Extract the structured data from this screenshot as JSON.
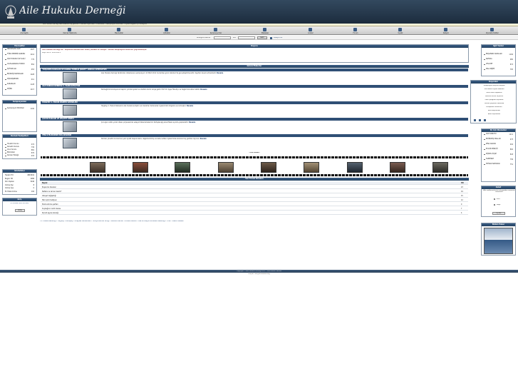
{
  "header": {
    "title": "Aile Hukuku Derneği",
    "ticker": "Aile Hukuku Derneği web sitesine hoş geldiniz • Dernek duyuruları • Etkinlikler • Sempozyum bildirileri • Üyelik bilgileri için tıklayınız"
  },
  "nav": [
    {
      "label": "Ana Sayfa"
    },
    {
      "label": "Dernek Hakkında"
    },
    {
      "label": "Mevzuatlar"
    },
    {
      "label": "Içtihatlar"
    },
    {
      "label": "Sempozyumlar"
    },
    {
      "label": "Makaleler"
    },
    {
      "label": "Linkler"
    },
    {
      "label": "Forum"
    },
    {
      "label": "Üyelik"
    },
    {
      "label": "İletişim"
    },
    {
      "label": "Ziyaretçi Defteri"
    }
  ],
  "search": {
    "label": "Aradığınız Kelime",
    "in_label": "Ara",
    "go": "Getir",
    "advanced": "Detaylı Ara"
  },
  "left": {
    "box1_title": "Mevzuatlar",
    "box1_items": [
      {
        "label": "ANAYASADA AİLE",
        "count": "1027"
      },
      {
        "label": "TÜRK MEDENİ KANUNU",
        "count": "1214"
      },
      {
        "label": "AİLE HUKUKU İLE İLGİLİ",
        "count": "779"
      },
      {
        "label": "ULUSLARARASI HUKUK",
        "count": "854"
      },
      {
        "label": "İÇTİHATLAR",
        "count": "953"
      },
      {
        "label": "BİLİRKİŞİ RAPORLARI",
        "count": "1028"
      },
      {
        "label": "SÖZLEŞMELER",
        "count": "911"
      },
      {
        "label": "KARARLAR",
        "count": "1128"
      },
      {
        "label": "DİĞER",
        "count": "1217"
      }
    ],
    "box2_title": "Sempozyumlar",
    "box2_items": [
      {
        "label": "Sempozyum Bildirileri",
        "count": "1190"
      }
    ],
    "box3_title": "Dernek Faaliyetleri",
    "box3_items": [
      {
        "label": "Yönetim Kurulu",
        "count": "974"
      },
      {
        "label": "Denetim Kurulu",
        "count": "736"
      },
      {
        "label": "Onur Kurulu",
        "count": "881"
      },
      {
        "label": "Etkinlikler",
        "count": "879"
      },
      {
        "label": "Dernek Tüzüğü",
        "count": "933"
      }
    ],
    "stats_title": "İstatistikler",
    "stats": [
      {
        "label": "Toplam Hit",
        "value": "4843941"
      },
      {
        "label": "Bugün Hit",
        "value": "1486"
      },
      {
        "label": "Dün Yapılan",
        "value": "3246"
      },
      {
        "label": "Online Kişi",
        "value": "8"
      },
      {
        "label": "Online Üye",
        "value": "0"
      },
      {
        "label": "En Fazla Online",
        "value": "192"
      }
    ],
    "login_title": "Giriş",
    "login_text": "UYELIKSIZ GİR. KAYDOL",
    "login_button": "Giriş"
  },
  "center": {
    "top_notice": "Aile Hukuku Derneği'nin \"Boşanma Davalarında Tedbir, Nafaka ve Velayet\" konulu sempozyum bildirileri yayınlanmıştır.",
    "top_notice2": "Kayıt Tarihi: 18.04.2011",
    "duyuru_title": "Duyuru",
    "news_title": "Güncel Haberler",
    "news": [
      {
        "head": "\"BOŞANMA DAVALARI VE KADINA YÖNELİK ŞİDDET\" KONULU SEMPOZYUM",
        "body": "Aile Hukuku Derneği tarafından düzenlenen sempozyum 12 Mart 2011 Cumartesi günü İstanbul'da gerçekleştirilecektir. Kayıtlar devam etmektedir.",
        "more": "Devamı"
      },
      {
        "head": "AİLE HUKUKU DERNEĞİ 5. YILINI KUTLUYOR",
        "body": "Derneğimiz kuruluşunun beşinci yılında üyeleri ve dostları ile bir araya geldi. Prof. Dr. Ayşe Havutçu ve değerli konuklar katıldı.",
        "more": "Devamı"
      },
      {
        "head": "YARGITAY 2. HUKUK DAİRESİ KARARLARI",
        "body": "Yargıtay 2. Hukuk Dairesinin aile hukukuna ilişkin son kararları derlenerek üyelerimizin bilgisine sunulmuştur.",
        "more": "Devamı"
      },
      {
        "head": "ÇOCUK HAKLARI VE VELAYET PANELİ",
        "body": "Çocuğun üstün yararı ilkesi çerçevesinde velayet düzenlemelerinin tartışılacağı panel Nisan ayında yapılacaktır.",
        "more": "Devamı"
      },
      {
        "head": "YENİ ÜYELERİMİZE HOŞ GELDİNİZ",
        "body": "Dernek yönetim kurulumuz yeni üyelik başvurularını değerlendirmiş ve kabul edilen üyelerimize aramıza hoş geldiniz diyoruz.",
        "more": "Devamı"
      }
    ],
    "gallery_title": "Foto Galeri",
    "gallery": [
      "Sempozyum 1",
      "Sempozyum 2",
      "Sempozyum 3",
      "Panel",
      "Toplantı",
      "Konferans",
      "Kutlama",
      "Seminer",
      "Ödül Töreni"
    ],
    "table_title": "Son Forum Konuları",
    "table_header": {
      "c1": "Başlık",
      "c2": "Hit"
    },
    "table_rows": [
      {
        "c1": "Boşanma Davaları",
        "c2": "23"
      },
      {
        "c1": "Nafaka ne zaman kesilir?",
        "c2": "19"
      },
      {
        "c1": "Velayet değişikliği",
        "c2": "15"
      },
      {
        "c1": "Mal rejimi tasfiyesi",
        "c2": "12"
      },
      {
        "c1": "Evlat edinme şartları",
        "c2": "9"
      },
      {
        "c1": "Soybağının reddi davası",
        "c2": "7"
      },
      {
        "c1": "Ziynet eşyası alacağı",
        "c2": "4"
      }
    ],
    "links_line": "T.C. Adalet Bakanlığı • Yargıtay • Danıştay • Anayasa Mahkemesi • Türkiye Barolar Birliği • İstanbul Barosu • Ankara Barosu • Aile ve Sosyal Politikalar Bakanlığı • UYAP • Resmi Gazete"
  },
  "right": {
    "box1_title": "Ilgili Yazılar",
    "box1_items": [
      {
        "label": "BOŞANMA DAVALARI",
        "count": "1184"
      },
      {
        "label": "NAFAKA",
        "count": "980"
      },
      {
        "label": "VELAYET",
        "count": "872"
      },
      {
        "label": "MAL REJİMİ",
        "count": "765"
      }
    ],
    "box2_title": "Duyurular",
    "box2_items": [
      "Sempozyum kayıtları başladı",
      "Yeni dönem üyelik aidatları",
      "Genel kurul toplantısı",
      "Yönetim kurulu seçimleri",
      "Panel programı açıklandı",
      "Dernek yayınları hakkında",
      "Kütüphane hizmetleri",
      "Burs başvuruları",
      "Basın açıklaması"
    ],
    "box3_title": "En Cok Okunanlar",
    "box3_items": [
      {
        "label": "AİLE KONUTU",
        "count": "1211"
      },
      {
        "label": "EDİNİLMİŞ MALLAR",
        "count": "973"
      },
      {
        "label": "ZİNA DAVASI",
        "count": "904"
      },
      {
        "label": "EVLİLİK BİRLİĞİ",
        "count": "862"
      },
      {
        "label": "KİŞİSEL İLİŞKİ",
        "count": "818"
      },
      {
        "label": "TAZMİNAT",
        "count": "799"
      },
      {
        "label": "İSTİRAK NAFAKASI",
        "count": "751"
      }
    ],
    "poll_title": "Anket",
    "poll_question": "Aile mahkemelerinin işleyişinden memnun musunuz?",
    "poll_options": [
      "Evet",
      "Hayır"
    ],
    "poll_button": "Oy Ver",
    "ad_title": "Bizden Haber"
  },
  "footer": {
    "text": "Copyright © Aile Hukuku Derneği 2011 - Tüm Hakları Saklıdır",
    "sub": "İletişim: info@ailehukuku.org"
  }
}
